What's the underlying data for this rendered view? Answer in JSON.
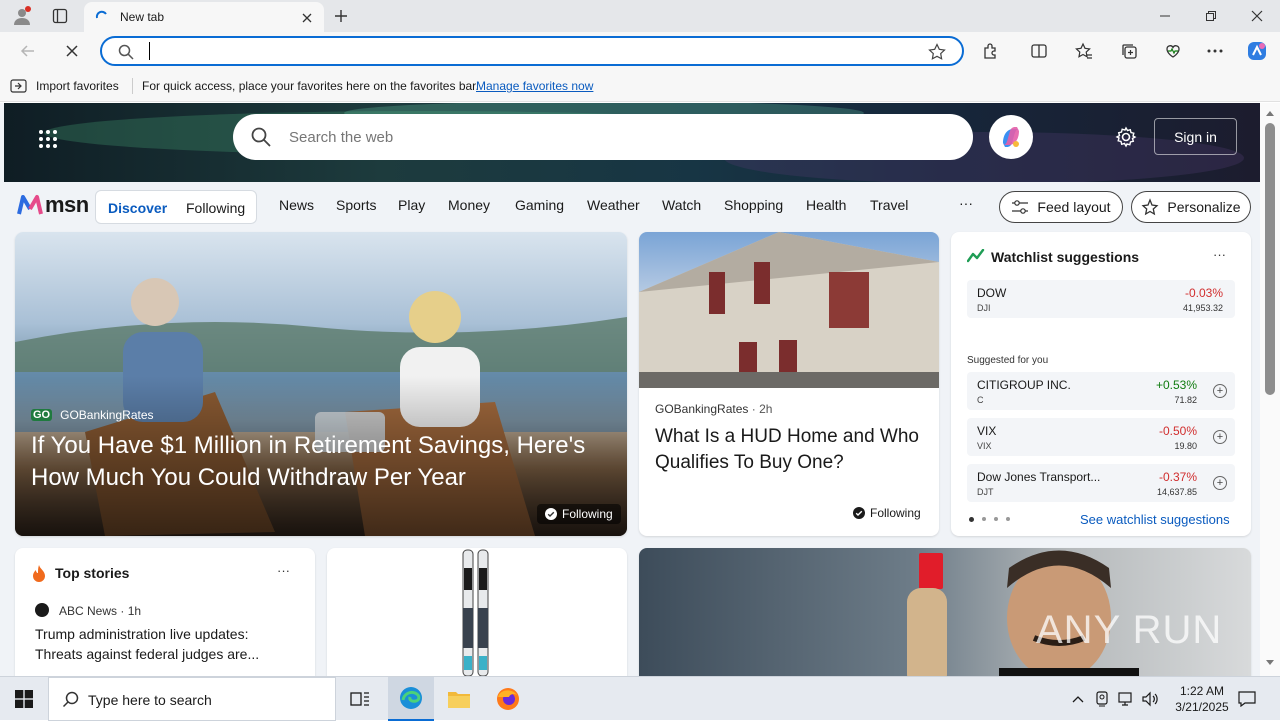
{
  "browser": {
    "tab_title": "New tab",
    "address_value": "",
    "favbar": {
      "import_label": "Import favorites",
      "message": "For quick access, place your favorites here on the favorites bar.",
      "manage_link": "Manage favorites now"
    }
  },
  "msn": {
    "search_placeholder": "Search the web",
    "sign_in": "Sign in",
    "logo_text": "msn",
    "discover": "Discover",
    "following": "Following",
    "nav": [
      "News",
      "Sports",
      "Play",
      "Money",
      "Gaming",
      "Weather",
      "Watch",
      "Shopping",
      "Health",
      "Travel"
    ],
    "more": "···",
    "feed_layout": "Feed layout",
    "personalize": "Personalize"
  },
  "hero": {
    "source": "GOBankingRates",
    "source_badge": "GO",
    "title": "If You Have $1 Million in Retirement Savings, Here's How Much You Could Withdraw Per Year",
    "following": "Following"
  },
  "card2": {
    "source": "GOBankingRates",
    "time": "· 2h",
    "title": "What Is a HUD Home and Who Qualifies To Buy One?",
    "following": "Following"
  },
  "watchlist": {
    "title": "Watchlist suggestions",
    "more": "···",
    "main": {
      "name": "DOW",
      "ticker": "DJI",
      "change": "-0.03%",
      "price": "41,953.32"
    },
    "suggested_label": "Suggested for you",
    "items": [
      {
        "name": "CITIGROUP INC.",
        "ticker": "C",
        "change": "+0.53%",
        "price": "71.82"
      },
      {
        "name": "VIX",
        "ticker": "VIX",
        "change": "-0.50%",
        "price": "19.80"
      },
      {
        "name": "Dow Jones Transport...",
        "ticker": "DJT",
        "change": "-0.37%",
        "price": "14,637.85"
      }
    ],
    "see_link": "See watchlist suggestions"
  },
  "topstories": {
    "title": "Top stories",
    "more": "···",
    "source": "ABC News",
    "time": "· 1h",
    "headline": "Trump administration live updates: Threats against federal judges are..."
  },
  "watermark": "ANY RUN",
  "taskbar": {
    "search_placeholder": "Type here to search",
    "time": "1:22 AM",
    "date": "3/21/2025"
  }
}
